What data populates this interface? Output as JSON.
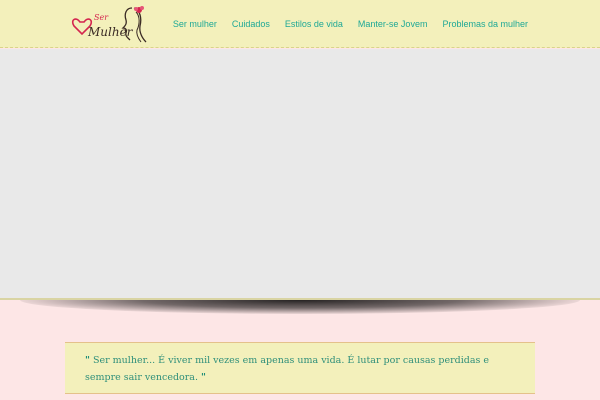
{
  "header": {
    "logo": {
      "text_top": "Ser",
      "text_bottom": "Mulher",
      "icon": "woman-silhouette-heart-logo"
    },
    "nav": [
      {
        "label": "Ser mulher"
      },
      {
        "label": "Cuidados"
      },
      {
        "label": "Estilos de vida"
      },
      {
        "label": "Manter-se Jovem"
      },
      {
        "label": "Problemas da mulher"
      }
    ]
  },
  "quote": {
    "open_mark": "\"",
    "text": "Ser mulher... É viver mil vezes em apenas uma vida. É lutar por causas perdidas e sempre sair vencedora.",
    "close_mark": "\""
  },
  "colors": {
    "header_bg": "#f3f0bb",
    "nav_text": "#1fa896",
    "hero_bg": "#e9e9e9",
    "page_bg": "#fde6e6",
    "quote_text": "#2f8f7a",
    "logo_accent": "#d4264f"
  }
}
